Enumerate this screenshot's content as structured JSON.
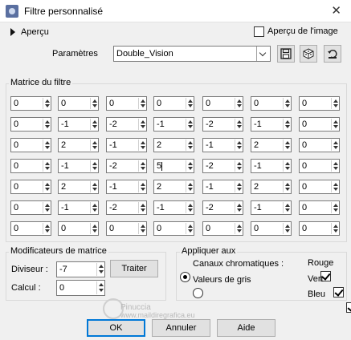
{
  "window": {
    "title": "Filtre personnalisé"
  },
  "apercu": {
    "label": "Aperçu",
    "image_label": "Aperçu de l'image",
    "image_checked": false
  },
  "params": {
    "label": "Paramètres",
    "preset": "Double_Vision"
  },
  "matrix": {
    "label": "Matrice du filtre",
    "rows": [
      [
        "0",
        "0",
        "0",
        "0",
        "0",
        "0",
        "0"
      ],
      [
        "0",
        "-1",
        "-2",
        "-1",
        "-2",
        "-1",
        "0"
      ],
      [
        "0",
        "2",
        "-1",
        "2",
        "-1",
        "2",
        "0"
      ],
      [
        "0",
        "-1",
        "-2",
        "5",
        "-2",
        "-1",
        "0"
      ],
      [
        "0",
        "2",
        "-1",
        "2",
        "-1",
        "2",
        "0"
      ],
      [
        "0",
        "-1",
        "-2",
        "-1",
        "-2",
        "-1",
        "0"
      ],
      [
        "0",
        "0",
        "0",
        "0",
        "0",
        "0",
        "0"
      ]
    ]
  },
  "modifiers": {
    "label": "Modificateurs de matrice",
    "diviseur_label": "Diviseur :",
    "diviseur_value": "-7",
    "calcul_label": "Calcul :",
    "calcul_value": "0",
    "traiter_label": "Traiter"
  },
  "apply": {
    "label": "Appliquer aux",
    "canaux_label": "Canaux chromatiques :",
    "gris_label": "Valeurs de gris",
    "rouge_label": "Rouge",
    "vert_label": "Vert",
    "bleu_label": "Bleu"
  },
  "buttons": {
    "ok": "OK",
    "annuler": "Annuler",
    "aide": "Aide"
  },
  "watermark": {
    "line1": "Pinuccia",
    "line2": "www.maildiregrafica.eu"
  }
}
